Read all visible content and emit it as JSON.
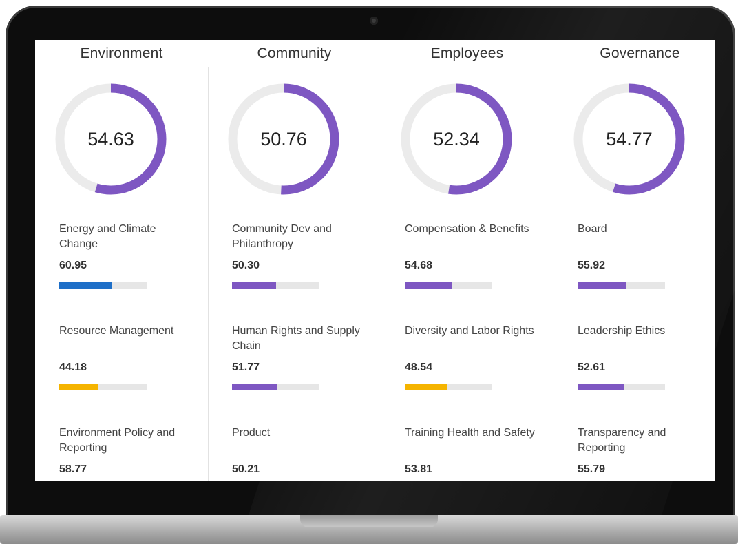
{
  "colors": {
    "purple": "#7e57c2",
    "blue": "#1e6fc8",
    "amber": "#f5b400",
    "track": "#e6e6e6"
  },
  "columns": [
    {
      "title": "Environment",
      "score": "54.63",
      "score_fraction": 0.5463,
      "metrics": [
        {
          "name": "Energy and Climate Change",
          "value": "60.95",
          "bar_fraction": 0.6095,
          "color": "#1e6fc8"
        },
        {
          "name": "Resource Management",
          "value": "44.18",
          "bar_fraction": 0.4418,
          "color": "#f5b400"
        },
        {
          "name": "Environment Policy and Reporting",
          "value": "58.77"
        }
      ]
    },
    {
      "title": "Community",
      "score": "50.76",
      "score_fraction": 0.5076,
      "metrics": [
        {
          "name": "Community Dev and Philanthropy",
          "value": "50.30",
          "bar_fraction": 0.503,
          "color": "#7e57c2"
        },
        {
          "name": "Human Rights and Supply Chain",
          "value": "51.77",
          "bar_fraction": 0.5177,
          "color": "#7e57c2"
        },
        {
          "name": "Product",
          "value": "50.21"
        }
      ]
    },
    {
      "title": "Employees",
      "score": "52.34",
      "score_fraction": 0.5234,
      "metrics": [
        {
          "name": "Compensation & Benefits",
          "value": "54.68",
          "bar_fraction": 0.5468,
          "color": "#7e57c2"
        },
        {
          "name": "Diversity and Labor Rights",
          "value": "48.54",
          "bar_fraction": 0.4854,
          "color": "#f5b400"
        },
        {
          "name": "Training Health and Safety",
          "value": "53.81"
        }
      ]
    },
    {
      "title": "Governance",
      "score": "54.77",
      "score_fraction": 0.5477,
      "metrics": [
        {
          "name": "Board",
          "value": "55.92",
          "bar_fraction": 0.5592,
          "color": "#7e57c2"
        },
        {
          "name": "Leadership Ethics",
          "value": "52.61",
          "bar_fraction": 0.5261,
          "color": "#7e57c2"
        },
        {
          "name": "Transparency and Reporting",
          "value": "55.79"
        }
      ]
    }
  ]
}
